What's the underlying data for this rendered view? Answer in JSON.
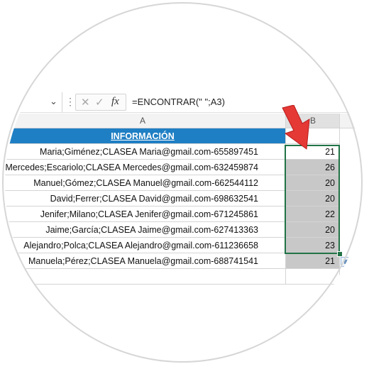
{
  "formula_bar": {
    "name_box_value": "",
    "cancel_icon": "x-icon",
    "confirm_icon": "check-icon",
    "function_symbol": "fx",
    "formula": "=ENCONTRAR(\" \";A3)"
  },
  "columns": {
    "a": "A",
    "b": "B"
  },
  "header_cell": "INFORMACIÓN",
  "rows": [
    {
      "text": "Maria;Giménez;CLASEA Maria@gmail.com-655897451",
      "value": "21"
    },
    {
      "text": "Mercedes;Escariolo;CLASEA Mercedes@gmail.com-632459874",
      "value": "26"
    },
    {
      "text": "Manuel;Gómez;CLASEA Manuel@gmail.com-662544112",
      "value": "20"
    },
    {
      "text": "David;Ferrer;CLASEA David@gmail.com-698632541",
      "value": "20"
    },
    {
      "text": "Jenifer;Milano;CLASEA Jenifer@gmail.com-671245861",
      "value": "22"
    },
    {
      "text": "Jaime;García;CLASEA Jaime@gmail.com-627413363",
      "value": "20"
    },
    {
      "text": "Alejandro;Polca;CLASEA Alejandro@gmail.com-611236658",
      "value": "23"
    },
    {
      "text": "Manuela;Pérez;CLASEA Manuela@gmail.com-688741541",
      "value": "21"
    }
  ],
  "colors": {
    "header_fill": "#1f7fc4",
    "selection_border": "#217346",
    "arrow": "#e53935"
  }
}
